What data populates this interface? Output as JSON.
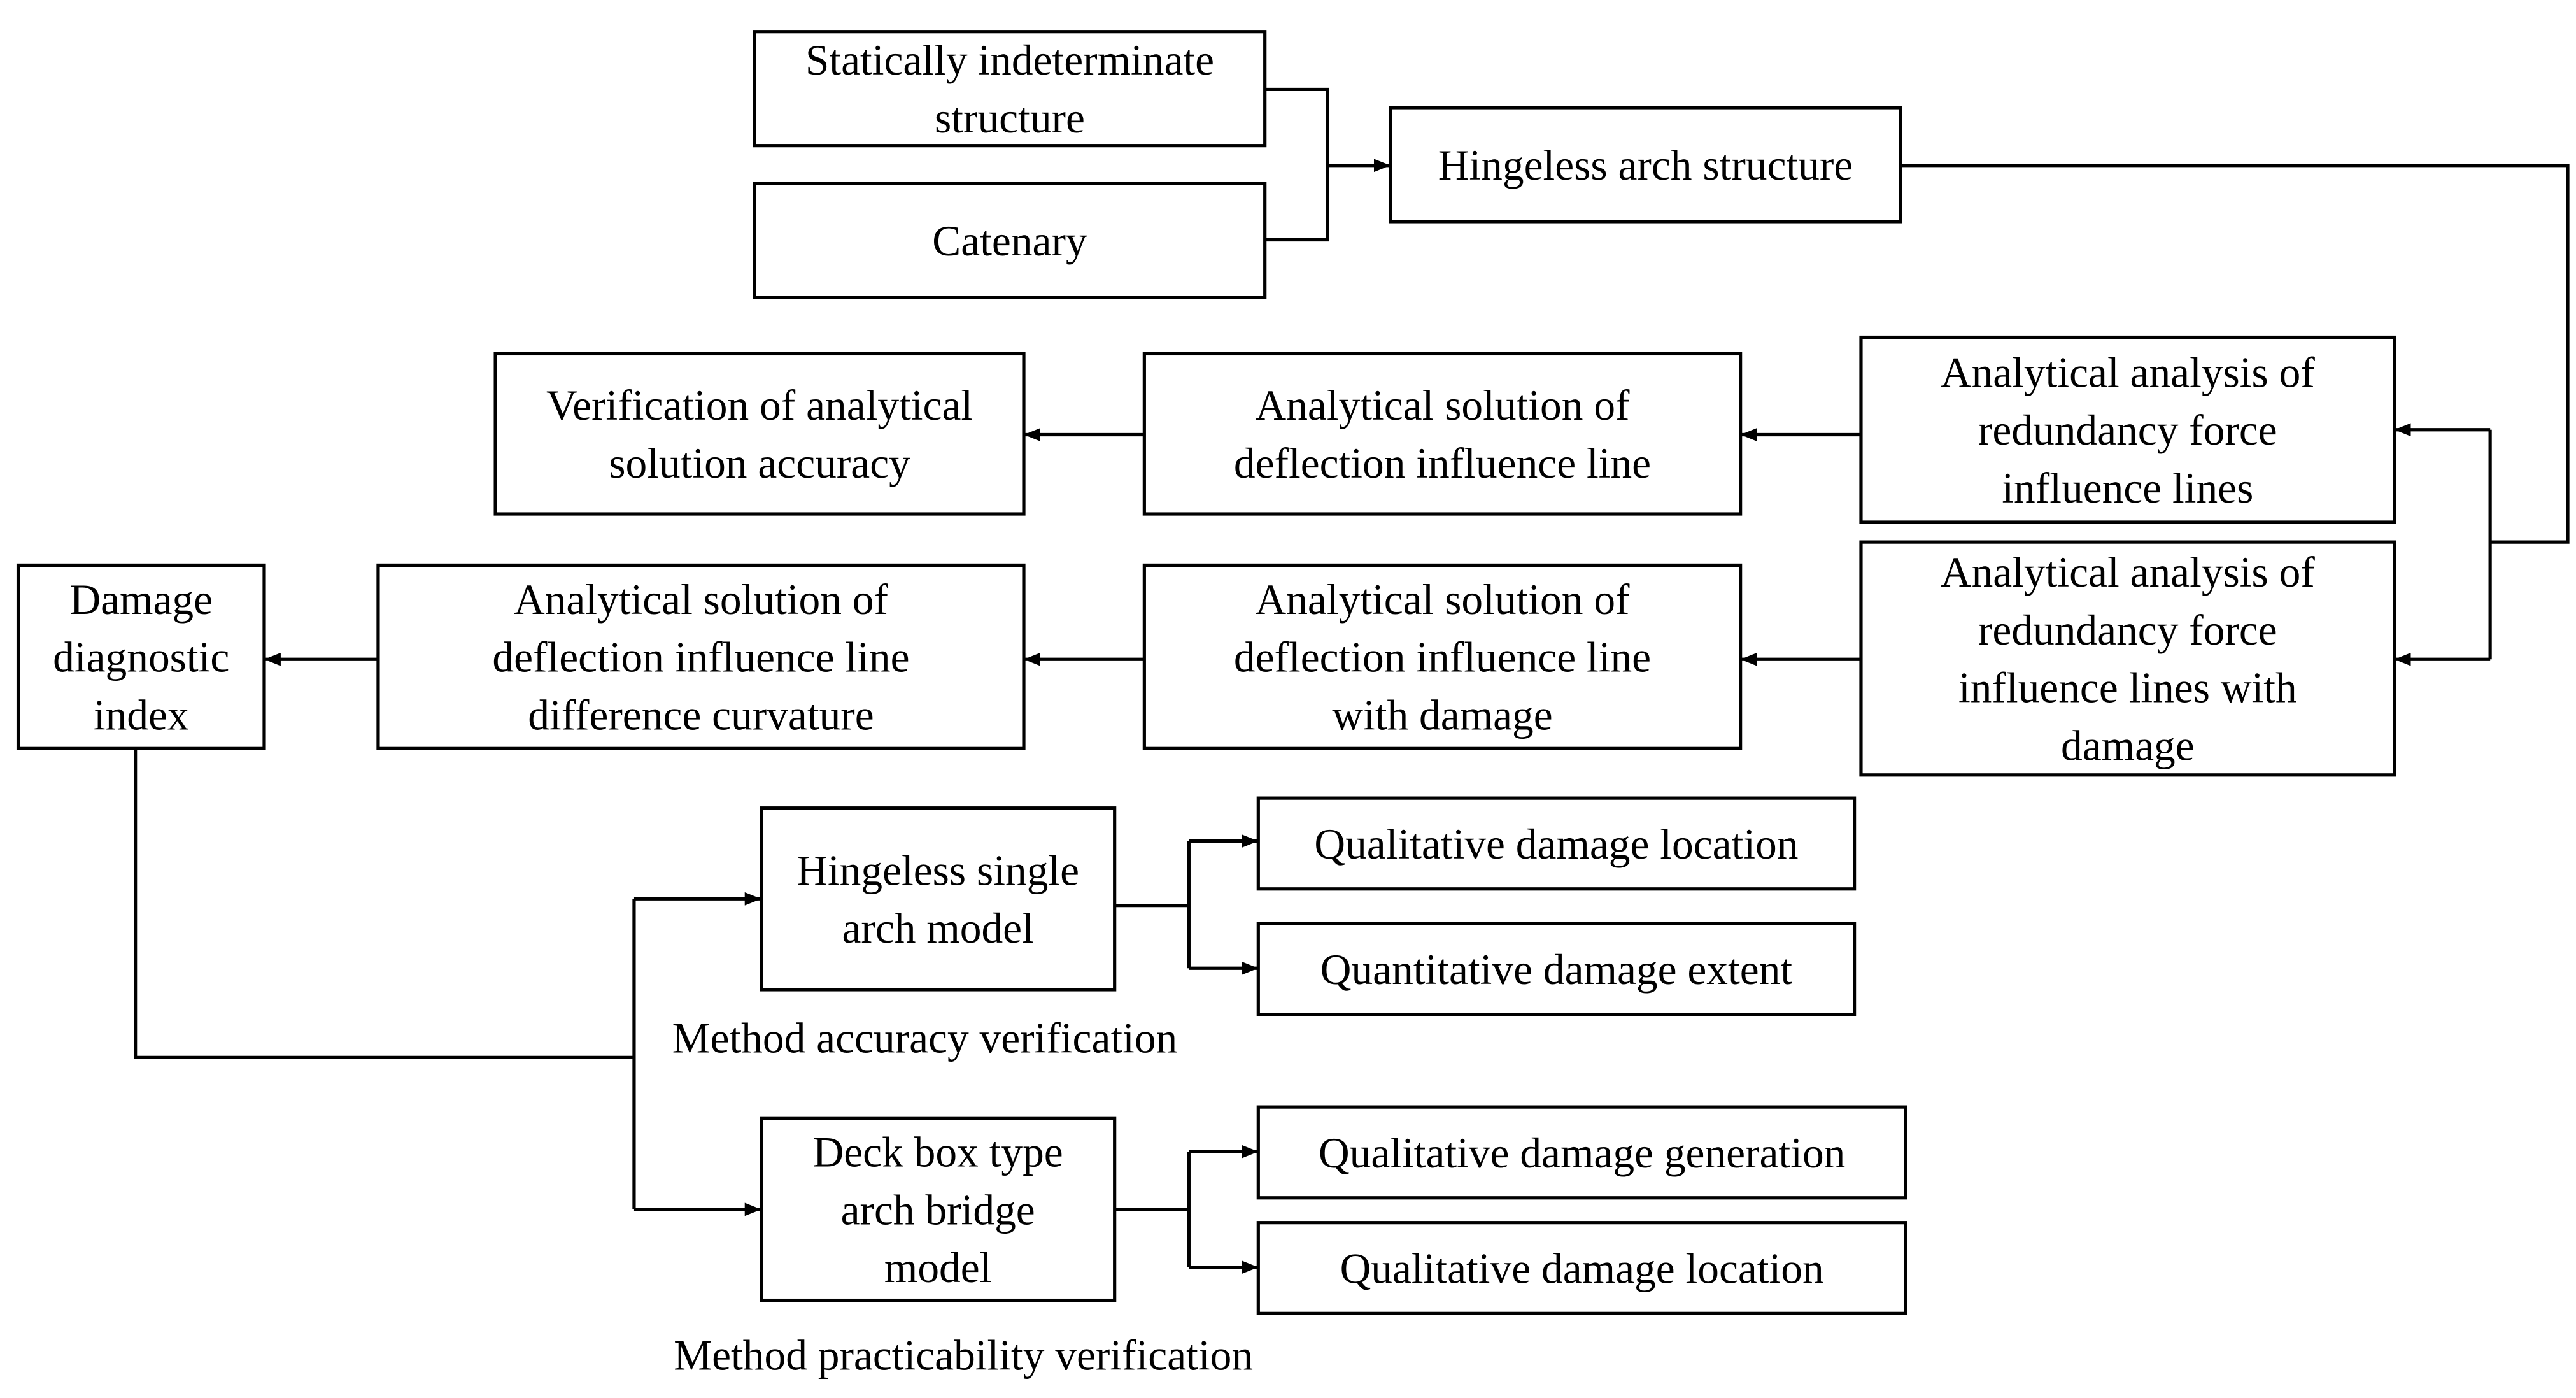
{
  "nodes": {
    "statically_indeterminate": {
      "lines": [
        "Statically indeterminate",
        "structure"
      ]
    },
    "catenary": {
      "lines": [
        "Catenary"
      ]
    },
    "hingeless_arch": {
      "lines": [
        "Hingeless arch structure"
      ]
    },
    "verification": {
      "lines": [
        "Verification of analytical",
        "solution accuracy"
      ]
    },
    "deflection_il": {
      "lines": [
        "Analytical solution of",
        "deflection influence line"
      ]
    },
    "redundancy_il": {
      "lines": [
        "Analytical analysis of",
        "redundancy force",
        "influence lines"
      ]
    },
    "redundancy_il_damage": {
      "lines": [
        "Analytical analysis of",
        "redundancy force",
        "influence lines with",
        "damage"
      ]
    },
    "damage_index": {
      "lines": [
        "Damage",
        "diagnostic",
        "index"
      ]
    },
    "difference_curvature": {
      "lines": [
        "Analytical solution of",
        "deflection influence line",
        "difference curvature"
      ]
    },
    "deflection_il_damage": {
      "lines": [
        "Analytical solution of",
        "deflection influence line",
        "with damage"
      ]
    },
    "single_arch_model": {
      "lines": [
        "Hingeless single",
        "arch model"
      ]
    },
    "qual_location_1": {
      "lines": [
        "Qualitative damage location"
      ]
    },
    "quant_extent": {
      "lines": [
        "Quantitative damage extent"
      ]
    },
    "deck_box_model": {
      "lines": [
        "Deck box type",
        "arch bridge",
        "model"
      ]
    },
    "qual_generation": {
      "lines": [
        "Qualitative damage generation"
      ]
    },
    "qual_location_2": {
      "lines": [
        "Qualitative damage location"
      ]
    }
  },
  "labels": {
    "accuracy": "Method accuracy verification",
    "practicability": "Method practicability verification"
  }
}
